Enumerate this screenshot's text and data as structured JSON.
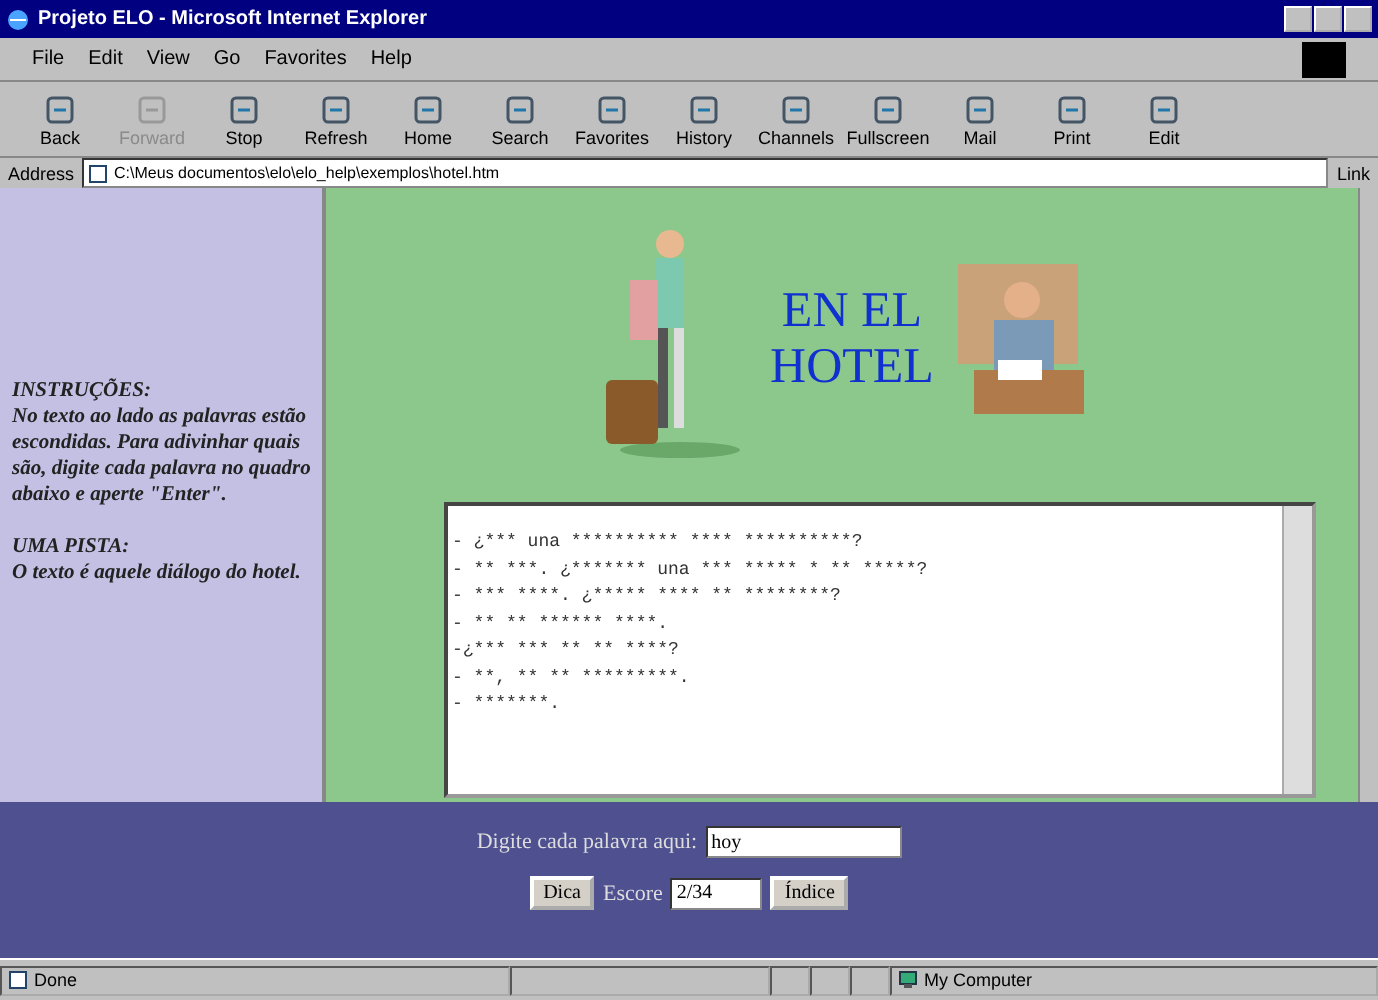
{
  "window": {
    "title": "Projeto ELO - Microsoft Internet Explorer"
  },
  "menu": [
    "File",
    "Edit",
    "View",
    "Go",
    "Favorites",
    "Help"
  ],
  "toolbar": [
    {
      "label": "Back",
      "disabled": false
    },
    {
      "label": "Forward",
      "disabled": true
    },
    {
      "label": "Stop",
      "disabled": false
    },
    {
      "label": "Refresh",
      "disabled": false
    },
    {
      "label": "Home",
      "disabled": false
    },
    {
      "label": "Search",
      "disabled": false
    },
    {
      "label": "Favorites",
      "disabled": false
    },
    {
      "label": "History",
      "disabled": false
    },
    {
      "label": "Channels",
      "disabled": false
    },
    {
      "label": "Fullscreen",
      "disabled": false
    },
    {
      "label": "Mail",
      "disabled": false
    },
    {
      "label": "Print",
      "disabled": false
    },
    {
      "label": "Edit",
      "disabled": false
    }
  ],
  "address": {
    "label": "Address",
    "value": "C:\\Meus documentos\\elo\\elo_help\\exemplos\\hotel.htm",
    "links": "Link"
  },
  "sidebar": {
    "heading1": "INSTRUÇÕES:",
    "text1": "No texto ao lado as palavras estão escondidas. Para adivinhar quais são, digite cada palavra no quadro abaixo e aperte \"Enter\".",
    "heading2": "UMA PISTA:",
    "text2": "O texto é aquele diálogo do hotel."
  },
  "banner": {
    "title_lines": [
      "EN EL",
      "HOTEL"
    ]
  },
  "dialogue": [
    "- ¿*** una ********** **** **********?",
    "- ** ***. ¿******* una *** ***** * ** *****?",
    "- *** ****. ¿***** **** ** ********?",
    "- ** ** ****** ****.",
    "-¿*** *** ** ** ****?",
    "- **, ** ** *********.",
    "- *******."
  ],
  "form": {
    "prompt": "Digite cada palavra aqui:",
    "input": "hoy",
    "hint_button": "Dica",
    "score_label": "Escore",
    "score": "2/34",
    "index_button": "Índice"
  },
  "status_bar": {
    "text": "Done",
    "zone": "My Computer"
  }
}
